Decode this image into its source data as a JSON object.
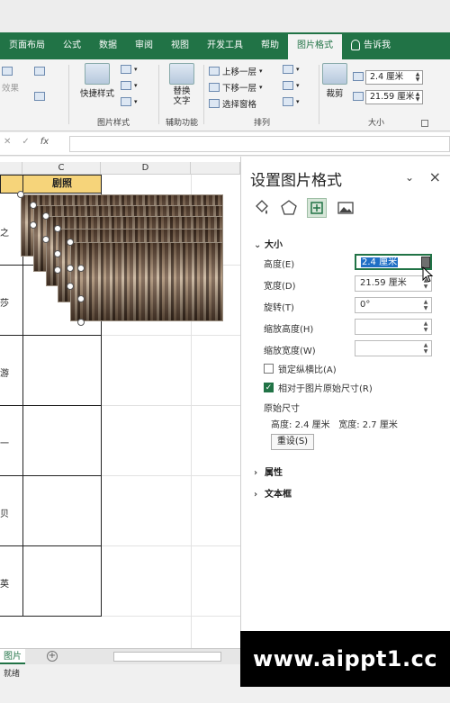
{
  "ribbon_tabs": [
    {
      "label": "页面布局",
      "active": false
    },
    {
      "label": "公式",
      "active": false
    },
    {
      "label": "数据",
      "active": false
    },
    {
      "label": "审阅",
      "active": false
    },
    {
      "label": "视图",
      "active": false
    },
    {
      "label": "开发工具",
      "active": false
    },
    {
      "label": "帮助",
      "active": false
    },
    {
      "label": "图片格式",
      "active": true
    },
    {
      "label": "告诉我",
      "active": false
    }
  ],
  "ribbon": {
    "quick_styles": "快捷样式",
    "group_picture_styles": "图片样式",
    "replace_text": "替换\n文字",
    "group_accessibility": "辅助功能",
    "bring_forward": "上移一层",
    "send_backward": "下移一层",
    "selection_pane": "选择窗格",
    "group_arrange": "排列",
    "crop": "裁剪",
    "height_value": "2.4 厘米",
    "width_value": "21.59 厘米",
    "group_size": "大小",
    "effects_partial": "效果"
  },
  "formula_bar": {
    "fx_label": "fx",
    "cancel": "✕",
    "confirm": "✓",
    "value": ""
  },
  "sheet": {
    "columns": [
      "C",
      "D"
    ],
    "header_cell": "剧照",
    "row_fragments": [
      "之",
      "莎",
      "游",
      "一",
      "贝",
      "英"
    ],
    "active_tab": "图片",
    "add_sheet": "+",
    "status": "就绪"
  },
  "pane": {
    "title": "设置图片格式",
    "size_section": "大小",
    "height_label": "高度(E)",
    "height_value": "2.4 厘米",
    "width_label": "宽度(D)",
    "width_value": "21.59 厘米",
    "rotation_label": "旋转(T)",
    "rotation_value": "0°",
    "scale_height_label": "缩放高度(H)",
    "scale_height_value": "",
    "scale_width_label": "缩放宽度(W)",
    "scale_width_value": "",
    "lock_aspect_label": "锁定纵横比(A)",
    "lock_aspect_checked": false,
    "relative_label": "相对于图片原始尺寸(R)",
    "relative_checked": true,
    "original_size_heading": "原始尺寸",
    "orig_height_label": "高度:",
    "orig_height_value": "2.4 厘米",
    "orig_width_label": "宽度:",
    "orig_width_value": "2.7 厘米",
    "reset_button": "重设(S)",
    "properties_section": "属性",
    "textbox_section": "文本框"
  },
  "watermark": "www.aippt1.cc",
  "colors": {
    "excel_green": "#217346",
    "header_fill": "#f6d47a",
    "selection_blue": "#1f6fc5"
  }
}
